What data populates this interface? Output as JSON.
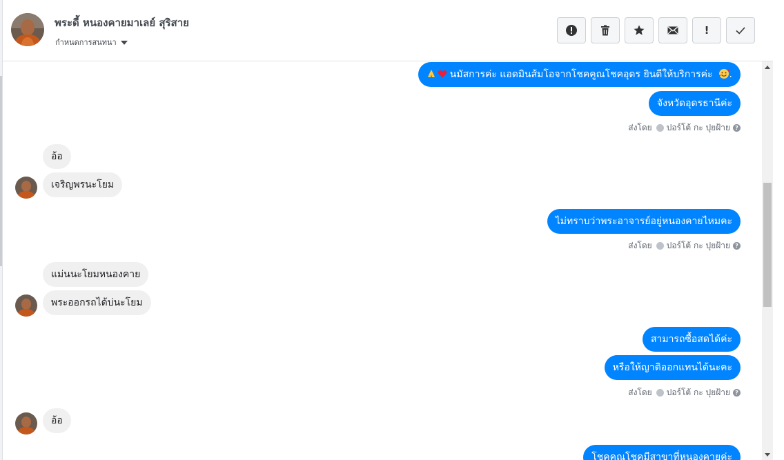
{
  "header": {
    "contact_name": "พระดี้ หนองคายมาเลย์ สุริสาย",
    "assign_label": "กำหนดการสนทนา",
    "toolbar": [
      {
        "name": "spam-button",
        "icon": "exclamation-circle-icon"
      },
      {
        "name": "delete-button",
        "icon": "trash-icon"
      },
      {
        "name": "star-button",
        "icon": "star-icon"
      },
      {
        "name": "mark-unread-button",
        "icon": "envelope-icon"
      },
      {
        "name": "follow-up-button",
        "icon": "exclamation-icon"
      },
      {
        "name": "mark-done-button",
        "icon": "check-icon"
      }
    ]
  },
  "messages": {
    "m1": "นมัสการค่ะ แอดมินส้มโอจากโชคคูณโชคอุดร ยินดีให้บริการค่ะ",
    "m1_trail": ".",
    "m2": "จังหวัดอุดรธานีค่ะ",
    "m3": "อ้อ",
    "m4": "เจริญพรนะโยม",
    "m5": "ไม่ทราบว่าพระอาจารย์อยู่หนองคายไหมคะ",
    "m6": "แม่นนะโยมหนองคาย",
    "m7": "พระออกรถได้บ่นะโยม",
    "m8": "สามารถซื้อสดได้ค่ะ",
    "m9": "หรือให้ญาติออกแทนได้นะคะ",
    "m10": "อ้อ",
    "m11": "โชคคูณโชคมีสาขาที่หนองคายค่ะ"
  },
  "sent_by": {
    "label": "ส่งโดย",
    "agent": "ปอร์โต้ กะ ปุยฝ้าย"
  },
  "colors": {
    "outgoing_bubble": "#0084ff",
    "incoming_bubble": "#f1f0f0",
    "text_dark": "#1c1e21"
  }
}
